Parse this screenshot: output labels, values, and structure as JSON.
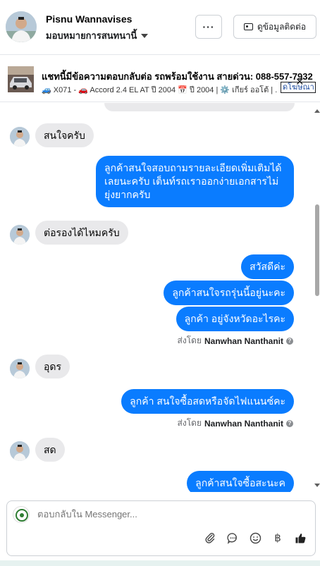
{
  "header": {
    "contact_name": "Pisnu Wannavises",
    "assign_label": "มอบหมายการสนทนานี้",
    "more_label": "···",
    "contact_info_label": "ดูข้อมูลติดต่อ"
  },
  "ad": {
    "title": "แชทนี้มีข้อความตอบกลับต่อ รถพร้อมใช้งาน สายด่วน: 088-557-7932",
    "subtitle": "🚙 X071 - 🚗 Accord 2.4 EL AT ปี 2004 📅 ปี 2004 | ⚙️ เกียร์ ออโต้ | ...",
    "link_label": "ดโฆษณา",
    "close_label": "✕"
  },
  "messages": [
    {
      "dir": "in",
      "text": "สนใจครับ"
    },
    {
      "dir": "out",
      "text": "ลูกค้าสนใจสอบถามรายละเอียดเพิ่มเติมได้เลยนะครับ เต็นท์รถเราออกง่ายเอกสารไม่ยุ่งยากครับ"
    },
    {
      "dir": "in",
      "text": "ต่อรองได้ไหมครับ"
    },
    {
      "dir": "out",
      "text": "สวัสดีค่ะ"
    },
    {
      "dir": "out",
      "text": "ลูกค้าสนใจรถรุ่นนี้อยู่นะคะ"
    },
    {
      "dir": "out",
      "text": "ลูกค้า อยู่จังหวัดอะไรคะ"
    },
    {
      "dir": "in",
      "text": "อุดร"
    },
    {
      "dir": "out",
      "text": "ลูกค้า สนใจซื้อสดหรือจัดไฟแนนซ์คะ"
    },
    {
      "dir": "in",
      "text": "สด"
    },
    {
      "dir": "out",
      "text": "ลูกค้าสนใจซื้อสะนะค"
    }
  ],
  "sent_by": {
    "prefix": "ส่งโดย",
    "agent": "Nanwhan Nanthanit"
  },
  "composer": {
    "placeholder": "ตอบกลับใน Messenger..."
  },
  "tools": {
    "baht_symbol": "฿"
  }
}
